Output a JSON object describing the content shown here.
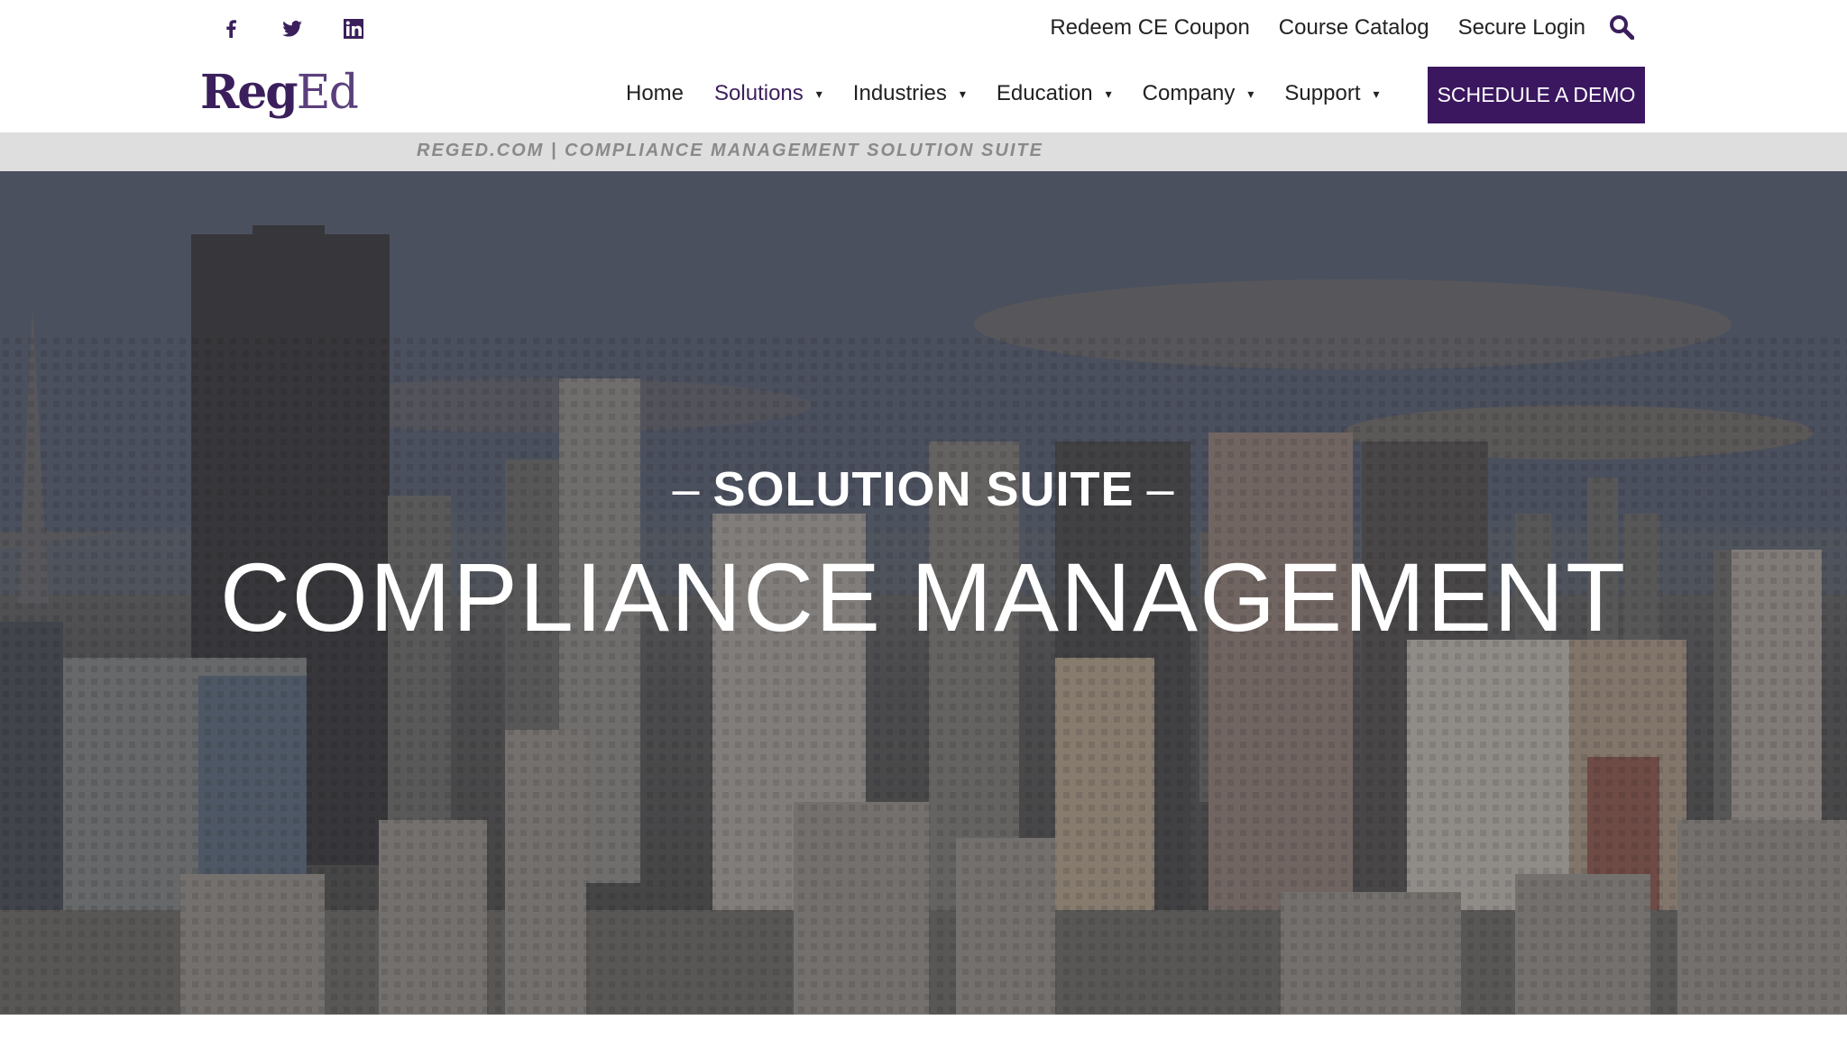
{
  "social": {
    "icons": [
      "facebook-icon",
      "twitter-icon",
      "linkedin-icon"
    ]
  },
  "utility_nav": {
    "redeem": "Redeem CE Coupon",
    "catalog": "Course Catalog",
    "login": "Secure Login",
    "search_icon": "search-icon"
  },
  "brand": {
    "logo_reg": "Reg",
    "logo_ed": "Ed",
    "color": "#3b1f5c"
  },
  "main_nav": {
    "items": [
      {
        "label": "Home",
        "has_dropdown": false
      },
      {
        "label": "Solutions",
        "has_dropdown": true,
        "active": true
      },
      {
        "label": "Industries",
        "has_dropdown": true
      },
      {
        "label": "Education",
        "has_dropdown": true
      },
      {
        "label": "Company",
        "has_dropdown": true
      },
      {
        "label": "Support",
        "has_dropdown": true
      }
    ],
    "caret": "▾",
    "cta": "SCHEDULE A DEMO",
    "cta_color": "#3b1760"
  },
  "breadcrumb": "REGED.COM | COMPLIANCE MANAGEMENT SOLUTION SUITE",
  "hero": {
    "dash": "–",
    "subtitle": "SOLUTION SUITE",
    "title": "COMPLIANCE MANAGEMENT"
  }
}
